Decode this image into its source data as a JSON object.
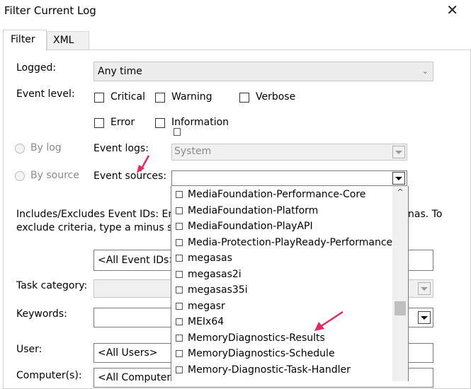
{
  "window": {
    "title": "Filter Current Log",
    "close_glyph": "✕"
  },
  "tabs": [
    {
      "label": "Filter"
    },
    {
      "label": "XML"
    }
  ],
  "logged": {
    "label": "Logged:",
    "value": "Any time"
  },
  "event_level": {
    "label": "Event level:",
    "options": [
      {
        "label": "Critical"
      },
      {
        "label": "Warning"
      },
      {
        "label": "Verbose"
      },
      {
        "label": "Error"
      },
      {
        "label": "Information"
      }
    ]
  },
  "by_log": {
    "label": "By log"
  },
  "by_source": {
    "label": "By source"
  },
  "event_logs": {
    "label": "Event logs:",
    "value": "System"
  },
  "event_sources": {
    "label": "Event sources:",
    "value": ""
  },
  "includes_text": {
    "line1_left": "Includes/Excludes Event IDs: Ente",
    "line1_right": "nas. To",
    "line2_left": "exclude criteria, type a minus sigr"
  },
  "event_ids": {
    "value": "<All Event IDs>"
  },
  "task_category": {
    "label": "Task category:"
  },
  "keywords": {
    "label": "Keywords:"
  },
  "user": {
    "label": "User:",
    "value": "<All Users>"
  },
  "computers": {
    "label": "Computer(s):",
    "value": "<All Computers>"
  },
  "source_list": {
    "items": [
      "MediaFoundation-Performance-Core",
      "MediaFoundation-Platform",
      "MediaFoundation-PlayAPI",
      "Media-Protection-PlayReady-Performance",
      "megasas",
      "megasas2i",
      "megasas35i",
      "megasr",
      "MEIx64",
      "MemoryDiagnostics-Results",
      "MemoryDiagnostics-Schedule",
      "Memory-Diagnostic-Task-Handler"
    ]
  },
  "colors": {
    "annotation_arrow": "#e8295f",
    "accent": "#0078d7"
  }
}
